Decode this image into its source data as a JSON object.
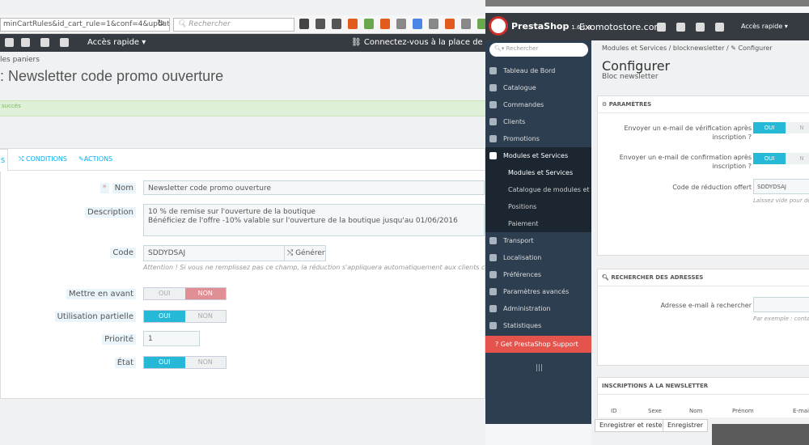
{
  "browser": {
    "url": "minCartRules&id_cart_rule=1&conf=4&updatecart_rule&",
    "search_placeholder": "Rechercher"
  },
  "left": {
    "admin_quick": "Accès rapide ▾",
    "marketplace": "Connectez-vous à la place de marché de Pr",
    "breadcrumb": "les paniers",
    "title": ": Newsletter code promo ouverture",
    "success_text": "succès",
    "tabs": [
      {
        "label": "s"
      },
      {
        "label": "Conditions"
      },
      {
        "label": "Actions"
      }
    ],
    "form": {
      "nom_label": "Nom",
      "nom_value": "Newsletter code promo ouverture",
      "description_label": "Description",
      "description_line1": "10 % de remise sur l'ouverture de la boutique",
      "description_line2": "Bénéficiez de l'offre -10% valable sur l'ouverture de la boutique jusqu'au 01/06/2016",
      "code_label": "Code",
      "code_value": "SDDYDSAJ",
      "generate_label": "Générer",
      "code_help": "Attention ! Si vous ne remplissez pas ce champ, la réduction s'appliquera automatiquement aux clients concernés.",
      "highlight_label": "Mettre en avant",
      "partial_label": "Utilisation partielle",
      "priority_label": "Priorité",
      "priority_value": "1",
      "state_label": "État",
      "oui": "OUI",
      "non": "NON"
    }
  },
  "right": {
    "brand": "PrestaShop",
    "version": "1.6.1.4",
    "shop_name": "Exomotostore.com",
    "quick_access": "Accès rapide ▾",
    "search_placeholder": "Rechercher",
    "sidebar": [
      {
        "label": "Tableau de Bord"
      },
      {
        "label": "Catalogue"
      },
      {
        "label": "Commandes"
      },
      {
        "label": "Clients"
      },
      {
        "label": "Promotions"
      },
      {
        "label": "Modules et Services"
      },
      {
        "label": "Modules et Services"
      },
      {
        "label": "Catalogue de modules et t..."
      },
      {
        "label": "Positions"
      },
      {
        "label": "Paiement"
      },
      {
        "label": "Transport"
      },
      {
        "label": "Localisation"
      },
      {
        "label": "Préférences"
      },
      {
        "label": "Paramètres avancés"
      },
      {
        "label": "Administration"
      },
      {
        "label": "Statistiques"
      },
      {
        "label": "Get PrestaShop Support"
      }
    ],
    "breadcrumb": "Modules et Services  /  blocknewsletter  /  ✎ Configurer",
    "title": "Configurer",
    "subtitle": "Bloc newsletter",
    "params_title": "PARAMÈTRES",
    "verif_label_1": "Envoyer un e-mail de vérification après",
    "verif_label_2": "inscription ?",
    "confirm_label_1": "Envoyer un e-mail de confirmation après",
    "confirm_label_2": "inscription ?",
    "code_label": "Code de réduction offert",
    "code_value": "SDDYDSAJ",
    "code_help": "Laissez vide pour dé",
    "search_title": "RECHERCHER DES ADRESSES",
    "email_search_label": "Adresse e-mail à rechercher",
    "email_help": "Par exemple : conta",
    "inscriptions_title": "INSCRIPTIONS À LA NEWSLETTER",
    "columns": [
      "ID",
      "Sexe",
      "Nom",
      "Prénom",
      "E-mail"
    ],
    "btn_save_stay": "Enregistrer et rester",
    "btn_save": "Enregistrer",
    "oui": "OUI",
    "non": "N"
  }
}
